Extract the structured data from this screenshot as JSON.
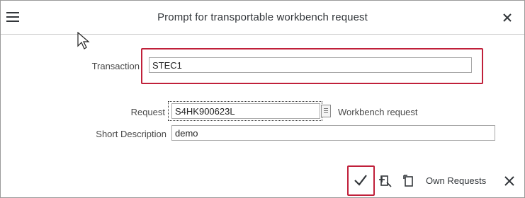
{
  "dialog": {
    "title": "Prompt for transportable workbench request"
  },
  "form": {
    "transaction_label": "Transaction",
    "transaction_value": "STEC1",
    "request_label": "Request",
    "request_value": "S4HK900623L",
    "request_note": "Workbench request",
    "short_desc_label": "Short Description",
    "short_desc_value": "demo"
  },
  "footer": {
    "own_requests_label": "Own Requests"
  },
  "icons": {
    "menu": "hamburger-icon",
    "close": "close-icon",
    "confirm": "checkmark-icon",
    "create": "create-request-icon",
    "copy": "document-icon",
    "cancel": "cancel-icon"
  },
  "colors": {
    "highlight": "#c0203a",
    "text": "#32363a",
    "border": "#a8a8a8"
  }
}
